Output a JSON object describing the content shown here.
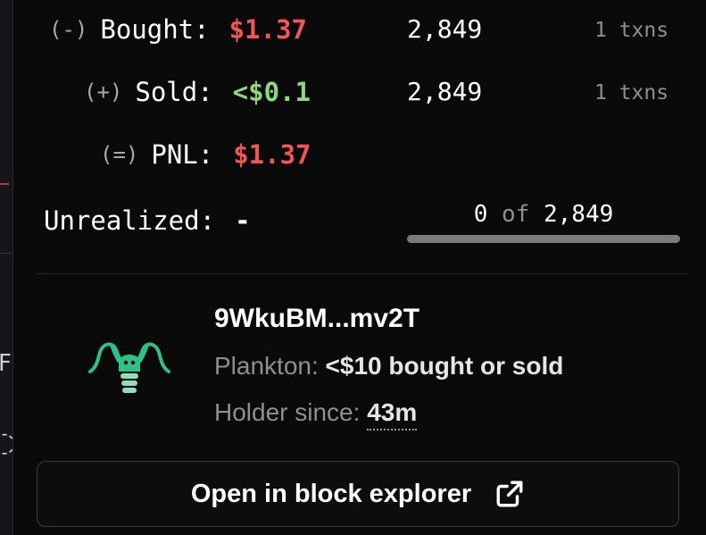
{
  "trades": {
    "bought": {
      "sign": "(-)",
      "label": "Bought:",
      "amount": "$1.37",
      "qty": "2,849",
      "txns": "1 txns"
    },
    "sold": {
      "sign": "(+)",
      "label": "Sold:",
      "amount": "<$0.1",
      "qty": "2,849",
      "txns": "1 txns"
    },
    "pnl": {
      "sign": "(=)",
      "label": "PNL:",
      "amount": "$1.37"
    },
    "unrealized": {
      "label": "Unrealized:",
      "value": "-"
    }
  },
  "holding": {
    "current": "0",
    "of_label": "of",
    "total": "2,849",
    "fraction": 0
  },
  "holder": {
    "wallet": "9WkuBM...mv2T",
    "tier_label": "Plankton:",
    "tier_desc": "<$10 bought or sold",
    "since_label": "Holder since:",
    "since_value": "43m",
    "avatar_icon": "plankton-icon"
  },
  "actions": {
    "explorer_label": "Open in block explorer",
    "explorer_icon": "external-link-icon"
  },
  "colors": {
    "negative": "#f0555a",
    "positive": "#8fd87a",
    "muted": "#8e8f95"
  }
}
